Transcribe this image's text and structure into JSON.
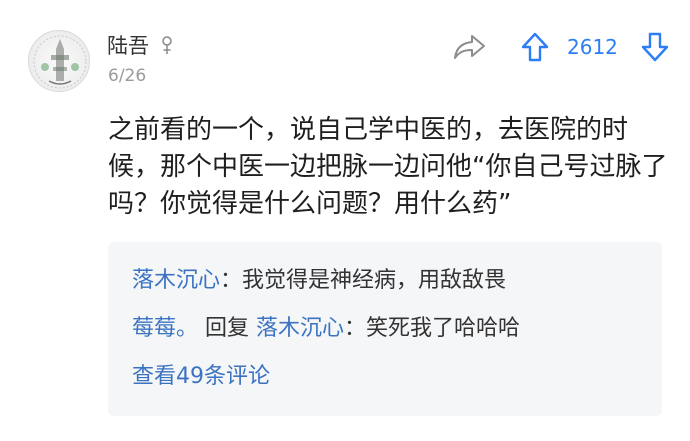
{
  "comment": {
    "username": "陆吾",
    "date": "6/26",
    "gender_icon": "male-symbol-icon",
    "vote_count": "2612",
    "body": "之前看的一个，说自己学中医的，去医院的时候，那个中医一边把脉一边问他“你自己号过脉了吗？你觉得是什么问题？用什么药”",
    "colors": {
      "accent": "#2d7df6",
      "link": "#3b73c2",
      "reply_bg": "#f5f6f8"
    }
  },
  "replies": [
    {
      "user": "落木沉心",
      "separator": "：",
      "text": "我觉得是神经病，用敌敌畏"
    },
    {
      "user": "莓莓。",
      "reply_word": " 回复 ",
      "reply_to": "落木沉心",
      "separator": "：",
      "text": "笑死我了哈哈哈"
    }
  ],
  "view_more": "查看49条评论"
}
